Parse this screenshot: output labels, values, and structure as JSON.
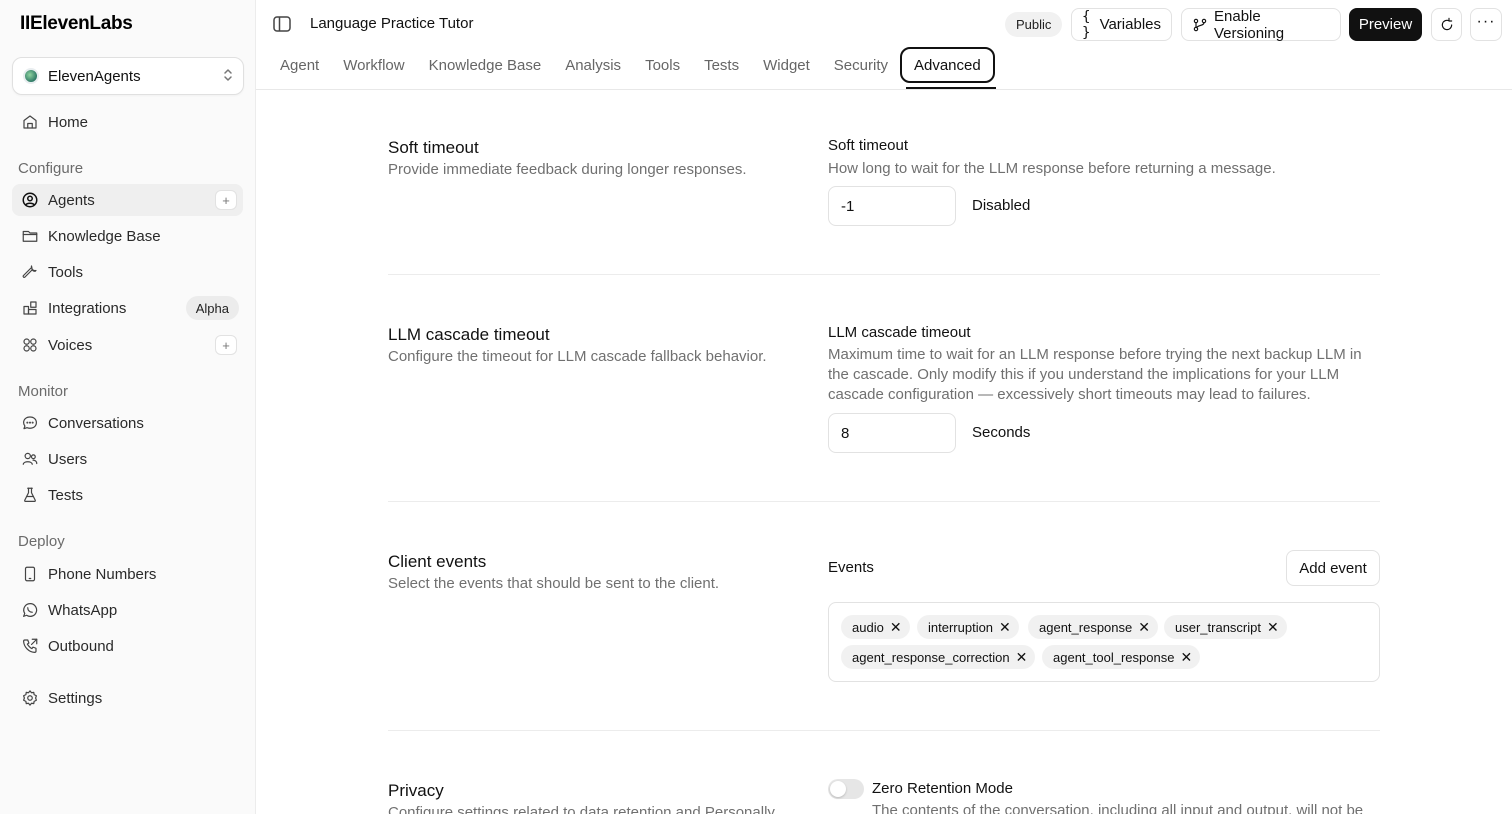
{
  "brand": "IIElevenLabs",
  "workspace": {
    "label": "ElevenAgents"
  },
  "sidebar": {
    "home": "Home",
    "sections": {
      "configure": "Configure",
      "monitor": "Monitor",
      "deploy": "Deploy"
    },
    "items": [
      {
        "label": "Agents",
        "icon": "user-circle-icon",
        "active": true,
        "plus": true
      },
      {
        "label": "Knowledge Base",
        "icon": "folder-icon"
      },
      {
        "label": "Tools",
        "icon": "wrench-icon"
      },
      {
        "label": "Integrations",
        "icon": "puzzle-icon",
        "badge": "Alpha"
      },
      {
        "label": "Voices",
        "icon": "voices-grid-icon",
        "plus": true
      },
      {
        "label": "Conversations",
        "icon": "chat-icon"
      },
      {
        "label": "Users",
        "icon": "users-icon"
      },
      {
        "label": "Tests",
        "icon": "flask-icon"
      },
      {
        "label": "Phone Numbers",
        "icon": "phone-device-icon"
      },
      {
        "label": "WhatsApp",
        "icon": "whatsapp-icon"
      },
      {
        "label": "Outbound",
        "icon": "phone-outgoing-icon"
      },
      {
        "label": "Settings",
        "icon": "gear-icon"
      }
    ]
  },
  "header": {
    "title": "Language Practice Tutor",
    "public_badge": "Public",
    "variables": "Variables",
    "enable_versioning": "Enable Versioning",
    "preview": "Preview"
  },
  "tabs": [
    {
      "label": "Agent"
    },
    {
      "label": "Workflow"
    },
    {
      "label": "Knowledge Base"
    },
    {
      "label": "Analysis"
    },
    {
      "label": "Tools"
    },
    {
      "label": "Tests"
    },
    {
      "label": "Widget"
    },
    {
      "label": "Security"
    },
    {
      "label": "Advanced",
      "active": true
    }
  ],
  "soft_timeout": {
    "title": "Soft timeout",
    "desc": "Provide immediate feedback during longer responses.",
    "field_label": "Soft timeout",
    "help": "How long to wait for the LLM response before returning a message.",
    "value": "-1",
    "unit": "Disabled"
  },
  "cascade_timeout": {
    "title": "LLM cascade timeout",
    "desc": "Configure the timeout for LLM cascade fallback behavior.",
    "field_label": "LLM cascade timeout",
    "help": "Maximum time to wait for an LLM response before trying the next backup LLM in the cascade. Only modify this if you understand the implications for your LLM cascade configuration — excessively short timeouts may lead to failures.",
    "value": "8",
    "unit": "Seconds"
  },
  "client_events": {
    "title": "Client events",
    "desc": "Select the events that should be sent to the client.",
    "field_label": "Events",
    "add_button": "Add event",
    "events": [
      "audio",
      "interruption",
      "agent_response",
      "user_transcript",
      "agent_response_correction",
      "agent_tool_response"
    ]
  },
  "privacy": {
    "title": "Privacy",
    "desc": "Configure settings related to data retention and Personally",
    "toggle_label": "Zero Retention Mode",
    "toggle_on": false,
    "help": "The contents of the conversation, including all input and output, will not be"
  }
}
